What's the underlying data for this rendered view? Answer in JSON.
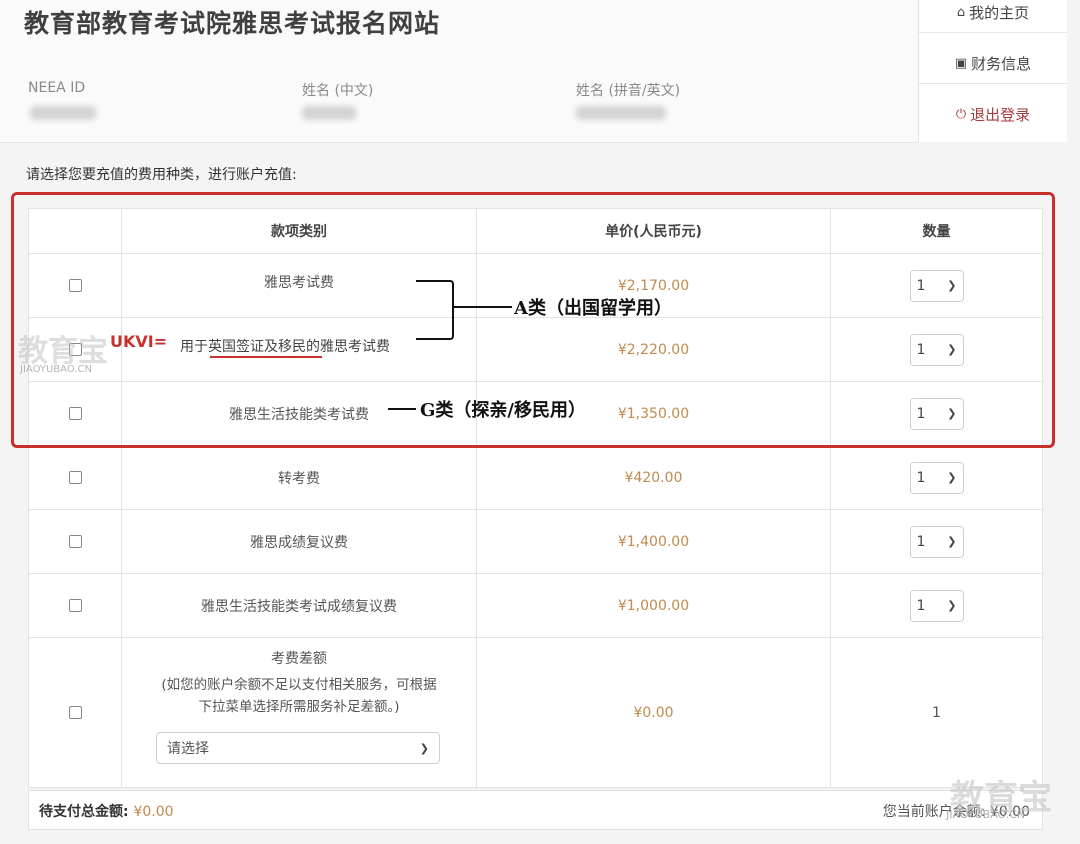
{
  "header": {
    "site_title": "教育部教育考试院雅思考试报名网站",
    "labels": {
      "neea_id": "NEEA ID",
      "name_cn": "姓名 (中文)",
      "name_en": "姓名 (拼音/英文)"
    }
  },
  "side_nav": {
    "home": "我的主页",
    "finance": "财务信息",
    "logout": "退出登录"
  },
  "instruction": "请选择您要充值的费用种类，进行账户充值:",
  "table": {
    "headers": {
      "category": "款项类别",
      "price": "单价(人民币元)",
      "qty": "数量"
    },
    "rows": [
      {
        "name": "雅思考试费",
        "price": "¥2,170.00",
        "qty": "1"
      },
      {
        "name": "用于英国签证及移民的雅思考试费",
        "price": "¥2,220.00",
        "qty": "1"
      },
      {
        "name": "雅思生活技能类考试费",
        "price": "¥1,350.00",
        "qty": "1"
      },
      {
        "name": "转考费",
        "price": "¥420.00",
        "qty": "1"
      },
      {
        "name": "雅思成绩复议费",
        "price": "¥1,400.00",
        "qty": "1"
      },
      {
        "name": "雅思生活技能类考试成绩复议费",
        "price": "¥1,000.00",
        "qty": "1"
      }
    ],
    "difference": {
      "name": "考费差额",
      "desc_line1": "(如您的账户余额不足以支付相关服务，可根据",
      "desc_line2": "下拉菜单选择所需服务补足差额。)",
      "select_placeholder": "请选择",
      "price": "¥0.00",
      "qty": "1"
    }
  },
  "footer": {
    "total_label": "待支付总金额:",
    "total_value": "¥0.00",
    "balance_label": "您当前账户余额:",
    "balance_value": "¥0.00"
  },
  "annotations": {
    "a_class": "A类（出国留学用）",
    "g_class": "G类（探亲/移民用）",
    "ukvi": "UKVI="
  },
  "watermark": {
    "text": "教育宝",
    "sub": "JIAOYUBAO.CN"
  },
  "colors": {
    "red_highlight": "#c9302c",
    "price": "#c08a4e"
  }
}
